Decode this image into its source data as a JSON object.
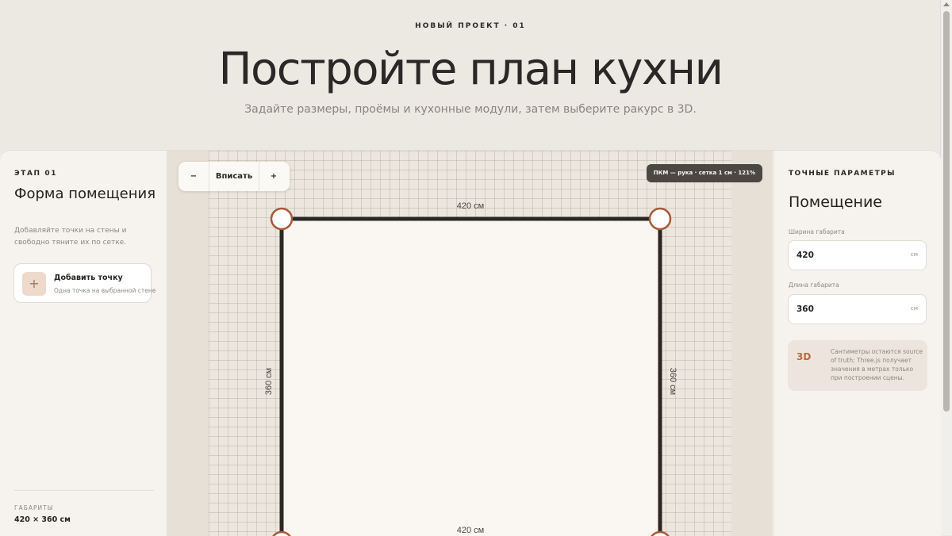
{
  "hero": {
    "eyebrow": "НОВЫЙ ПРОЕКТ · 01",
    "title": "Постройте план кухни",
    "subtitle": "Задайте размеры, проёмы и кухонные модули, затем выберите ракурс в 3D."
  },
  "left_panel": {
    "step": "ЭТАП 01",
    "title": "Форма помещения",
    "description": "Добавляйте точки на стены и свободно тяните их по сетке.",
    "add_point": {
      "icon": "plus-icon",
      "symbol": "+",
      "title": "Добавить точку",
      "subtitle": "Одна точка на выбранной стене"
    },
    "dimensions_label": "ГАБАРИТЫ",
    "dimensions_value": "420 × 360 см"
  },
  "canvas": {
    "zoom": {
      "out_label": "−",
      "fit_label": "Вписать",
      "in_label": "+"
    },
    "hint": "ПКМ — рука · сетка 1 см · 121%",
    "walls": {
      "top": "420 см",
      "bottom": "420 см",
      "left": "360 см",
      "right": "360 см"
    }
  },
  "right_panel": {
    "section_label": "ТОЧНЫЕ ПАРАМЕТРЫ",
    "title": "Помещение",
    "width": {
      "label": "Ширина габарита",
      "value": "420",
      "unit": "см"
    },
    "length": {
      "label": "Длина габарита",
      "value": "360",
      "unit": "см"
    },
    "note": {
      "badge": "3D",
      "text": "Сантиметры остаются source of truth; Three.js получает значения в метрах только при построении сцены."
    }
  },
  "colors": {
    "background": "#ece8e2",
    "panel": "#f6f3ee",
    "accent": "#b86a3e",
    "wall": "#2a2724",
    "handle_border": "#a75a3a"
  }
}
